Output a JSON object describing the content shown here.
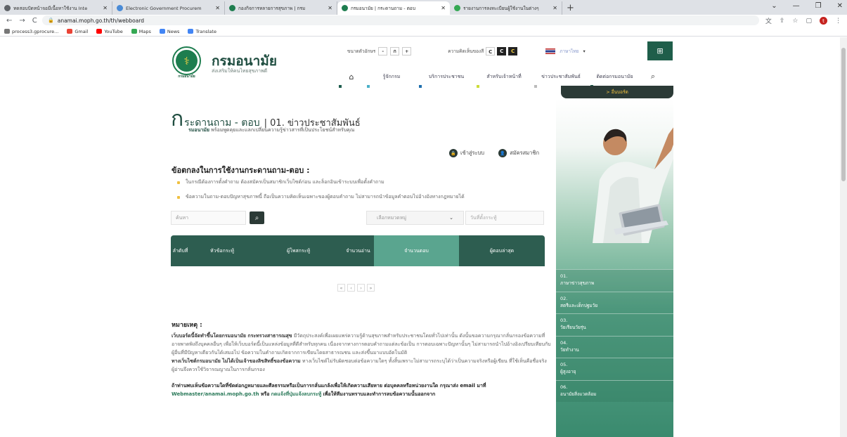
{
  "browser": {
    "tabs": [
      {
        "title": "ทดสอบปัดหน้าจอมีเนื้อหาใช้งาน Inte",
        "favicon_color": "#5f6368",
        "active": false
      },
      {
        "title": "Electronic Government Procurem",
        "favicon_color": "#4a8bd6",
        "active": false
      },
      {
        "title": "กองกิจการหลายการสุขภาพ | กรม",
        "favicon_color": "#1e7d4f",
        "active": false
      },
      {
        "title": "กรมอนามัย | กระดานถาม - ตอบ",
        "favicon_color": "#1e7d4f",
        "active": true
      },
      {
        "title": "รายงานการลงทะเบียนผู้ใช้งานในต่างๆ",
        "favicon_color": "#34a853",
        "active": false
      }
    ],
    "new_tab": "+",
    "url": "anamai.moph.go.th/th/webboard",
    "profile_initial": "t",
    "bookmarks": [
      {
        "label": "process3.gprocure...",
        "color": "#777"
      },
      {
        "label": "Gmail",
        "color": "#ea4335"
      },
      {
        "label": "YouTube",
        "color": "#ff0000"
      },
      {
        "label": "Maps",
        "color": "#34a853"
      },
      {
        "label": "News",
        "color": "#4285f4"
      },
      {
        "label": "Translate",
        "color": "#4285f4"
      }
    ]
  },
  "site": {
    "brand": "กรมอนามัย",
    "tagline": "ส่งเสริมให้คนไทยสุขภาพดี",
    "logo_caption": "กรมอนามัย",
    "font_size_label": "ขนาดตัวอักษร",
    "font_buttons": [
      "-",
      "ก",
      "+"
    ],
    "contrast_label": "ความคิดเห็นของสี",
    "contrast_buttons": [
      "C",
      "C",
      "C"
    ],
    "language": "ภาษาไทย",
    "nav": [
      "รู้จักกรม",
      "บริการประชาชน",
      "สำหรับเจ้าหน้าที่",
      "ข่าวประชาสัมพันธ์",
      "ติดต่อกรมอนามัย"
    ],
    "nav_markers": [
      "#1e5d4f",
      "#4ab0c8",
      "#1e6fae",
      "#cddc39",
      "#bbbbbb",
      "#1e5d4f"
    ],
    "top_badge": "> อื่นบอร์ด"
  },
  "board": {
    "title_initial": "ก",
    "title": "ระดานถาม - ตอบ",
    "title_suffix": "| 01. ข่าวประชาสัมพันธ์",
    "subtitle_bold": "รมอนามัย",
    "subtitle": "พร้อมพูดคุยและแลกเปลี่ยนความรู้ข่าวสารที่เป็นประโยชน์สำหรับคุณ",
    "login": "เข้าสู่ระบบ",
    "register": "สมัครสมาชิก",
    "terms_heading": "ข้อตกลงในการใช้งานกระดานถาม-ตอบ :",
    "terms": [
      "ในกรณีต้องการตั้งคำถาม ต้องสมัครเป็นสมาชิกเว็บไซต์ก่อน และล็อกอินเข้าระบบเพื่อตั้งคำถาม",
      "ข้อความในถาม-ตอบปัญหาสุขภาพนี้ ถือเป็นความคิดเห็นเฉพาะของผู้ตอบคำถาม ไม่สามารถนำข้อมูลคำตอบไปอ้างอิงทางกฎหมายได้"
    ],
    "search_placeholder": "ค้นหา",
    "category_placeholder": "เลือกหมวดหมู่",
    "date_placeholder": "วันที่ตั้งกระทู้",
    "table_headers": [
      "ลำดับที่",
      "หัวข้อกระทู้",
      "ผู้โพสกระทู้",
      "จำนวนอ่าน",
      "จำนวนตอบ",
      "ผู้ตอบล่าสุด"
    ],
    "pager": [
      "«",
      "‹",
      "›",
      "»"
    ],
    "note_heading": "หมายเหตุ :",
    "note_bold1": "เว็บบอร์ดนี้จัดทำขึ้นโดยกรมอนามัย กระทรวงสาธารณสุข",
    "note_text1": "มีวัตถุประสงค์เพื่อเผยแพร่ความรู้ด้านสุขภาพสำหรับประชาชนโดยทั่วไปเท่านั้น ดังนั้นขอความกรุณากลั่นกรองข้อความที่อาจพาดพิงถึงบุคคลอื่นๆ เพื่อให้เว็บบอร์ดนี้เป็นแหล่งข้อมูลที่ดีสำหรับทุกคน เนื่องจากทางการตอบคำถามแต่ละข้อเป็น การตอบเฉพาะปัญหานั้นๆ ไม่สามารถนำไปอ้างอิงเปรียบเทียบกับผู้อื่นที่มีปัญหาเดียวกันได้เสมอไป ข้อความในคำถามเกิดจากการเขียนโดยสาธารณชน และส่งขึ้นมาแบบอัตโนมัติ",
    "note_bold2": "ทางเว็บไซต์กรมอนามัย ไม่ได้เป็นเจ้าของลิขสิทธิ์ของข้อความ",
    "note_text2": "ทางเว็บไซต์ไม่รับผิดชอบต่อข้อความใดๆ ทั้งสิ้นเพราะไม่สามารถระบุได้ว่าเป็นความจริงหรือผู้เขียน ที่ใช้เห็นคือชื่อจริง ผู้อ่านจึงควรใช้วิจารณญาณในการกลั่นกรอง",
    "note_bold3": "ถ้าท่านพบเห็นข้อความใดที่ขัดต่อกฎหมายและศีลธรรมหรือเป็นการกลั่นแกล้งเพื่อให้เกิดความเสียหาย ต่อบุคคลหรือหน่วยงานใด กรุณาส่ง email มาที่",
    "note_email": "Webmaster/anamai.moph.go.th",
    "note_or": "หรือ",
    "note_flag": "กดแจ้งที่ปุ่มแจ้งลบกระทู้",
    "note_tail": "เพื่อให้ทีมงานทราบและทำการลบข้อความนั้นออกจาก"
  },
  "categories": [
    {
      "num": "01.",
      "label": "ภาษาข่าวสุขภาพ"
    },
    {
      "num": "02.",
      "label": "สตรีและเด็กปฐมวัย"
    },
    {
      "num": "03.",
      "label": "วัยเรียนวัยรุ่น"
    },
    {
      "num": "04.",
      "label": "วัยทำงาน"
    },
    {
      "num": "05.",
      "label": "ผู้สูงอายุ"
    },
    {
      "num": "06.",
      "label": "อนามัยสิ่งแวดล้อม"
    }
  ]
}
